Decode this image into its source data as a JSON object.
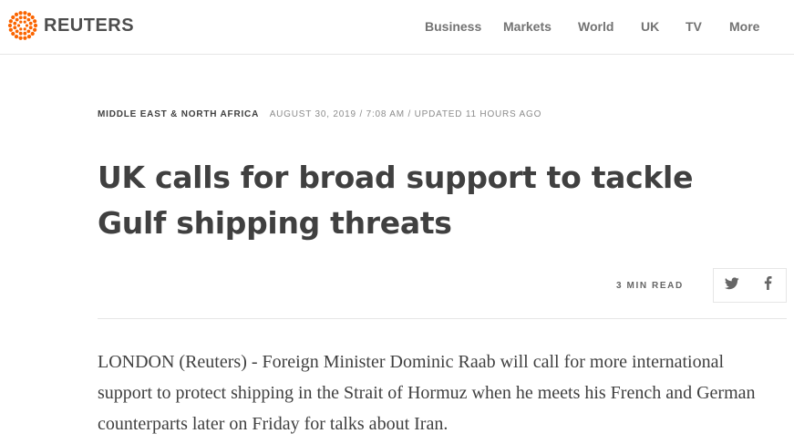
{
  "brand": {
    "name": "REUTERS",
    "logo_icon": "reuters-dot-ring-icon",
    "logo_color": "#fa6400"
  },
  "nav": {
    "items": [
      {
        "label": "Business"
      },
      {
        "label": "Markets"
      },
      {
        "label": "World"
      },
      {
        "label": "UK"
      },
      {
        "label": "TV"
      },
      {
        "label": "More"
      }
    ]
  },
  "article": {
    "section": "MIDDLE EAST & NORTH AFRICA",
    "timestamp": "AUGUST 30, 2019 / 7:08 AM / UPDATED 11 HOURS AGO",
    "headline": "UK calls for broad support to tackle Gulf shipping threats",
    "read_time": "3 MIN READ",
    "share": {
      "twitter_icon": "twitter-icon",
      "facebook_icon": "facebook-icon"
    },
    "body": "LONDON (Reuters) - Foreign Minister Dominic Raab will call for more international support to protect shipping in the Strait of Hormuz when he meets his French and German counterparts later on Friday for talks about Iran."
  },
  "colors": {
    "text": "#404040",
    "nav_text": "#737373",
    "muted": "#8c8c8c",
    "divider": "#e6e6e6",
    "icon": "#666666"
  }
}
